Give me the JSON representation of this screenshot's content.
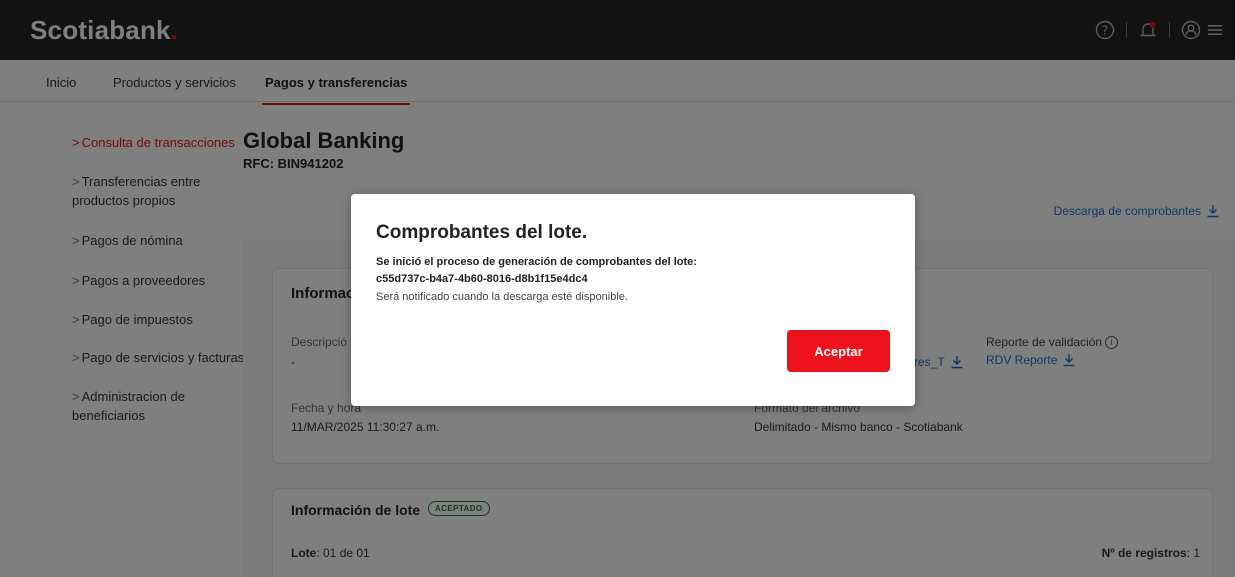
{
  "header": {
    "logo_text": "Scotiabank",
    "logo_dot": ".",
    "icons": [
      "help-icon",
      "notification-icon",
      "user-icon",
      "menu-icon"
    ]
  },
  "topnav": {
    "tabs": [
      {
        "label": "Inicio"
      },
      {
        "label": "Productos y servicios"
      },
      {
        "label": "Pagos y transferencias",
        "active": true
      }
    ]
  },
  "sidebar": {
    "items": [
      {
        "label": "Consulta de transacciones",
        "active": true
      },
      {
        "label": "Transferencias entre productos propios"
      },
      {
        "label": "Pagos de nómina"
      },
      {
        "label": "Pagos a proveedores"
      },
      {
        "label": "Pago de impuestos"
      },
      {
        "label": "Pago de servicios y facturas"
      },
      {
        "label": "Administracion de beneficiarios"
      }
    ]
  },
  "main": {
    "title": "Global Banking",
    "rfc": "RFC: BIN941202",
    "download_link": "Descarga de comprobantes",
    "card1": {
      "title": "Informaci",
      "desc_label": "Descripció",
      "desc_value": "-",
      "file_link": "res_T",
      "report_label": "Reporte de validación",
      "report_link": "RDV Reporte",
      "date_label": "Fecha y hora",
      "date_value": "11/MAR/2025 11:30:27 a.m.",
      "format_label": "Formato del archivo",
      "format_value": "Delimitado - Mismo banco - Scotiabank"
    },
    "card2": {
      "title": "Información de lote",
      "badge": "ACEPTADO",
      "lote_label": "Lote",
      "lote_value": ": 01 de 01",
      "records_label": "Nº de registros",
      "records_value": ": 1"
    }
  },
  "modal": {
    "title": "Comprobantes del lote.",
    "message": "Se inició el proceso de generación de comprobantes del lote:",
    "batch_id": "c55d737c-b4a7-4b60-8016-d8b1f15e4dc4",
    "note": "Será notificado cuando la descarga esté disponible.",
    "accept_label": "Aceptar"
  },
  "colors": {
    "brand_red": "#ec111a",
    "header_bg": "#252525",
    "link_blue": "#1d6fc4",
    "success_green": "#1a7a3c"
  }
}
